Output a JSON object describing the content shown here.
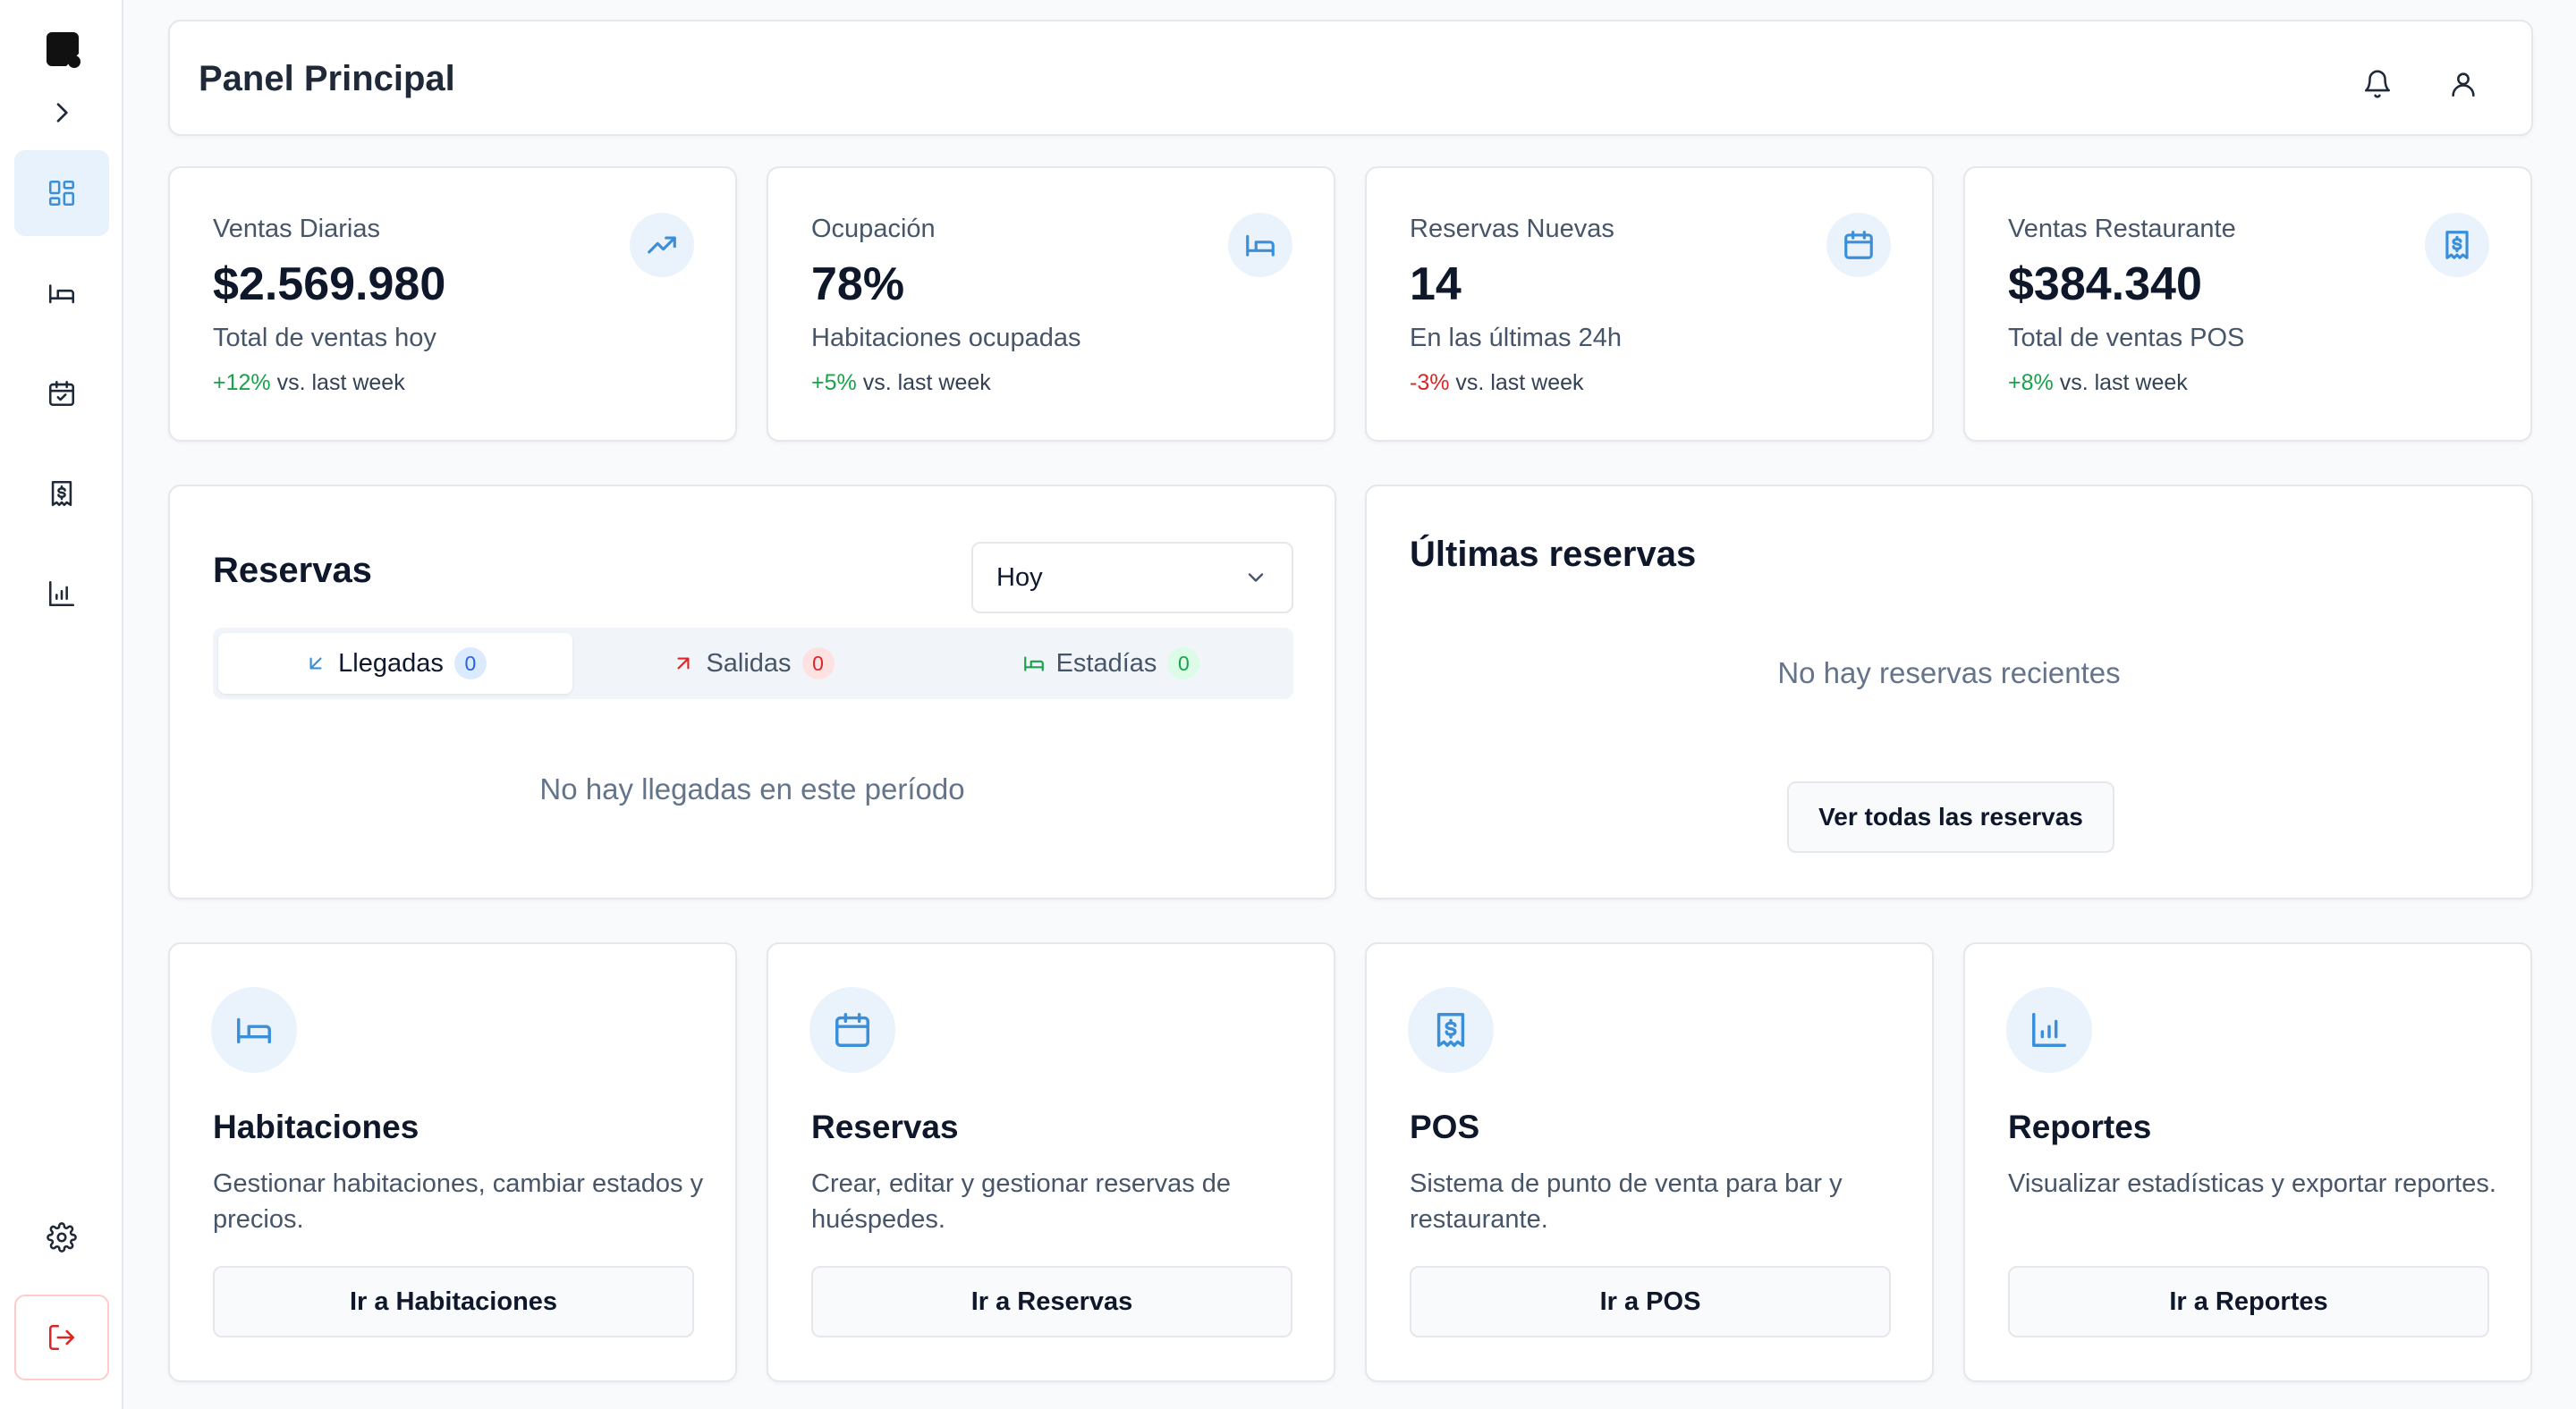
{
  "colors": {
    "accent": "#3b8fd9",
    "positive": "#16a34a",
    "negative": "#dc2626",
    "logout": "#dc2626"
  },
  "sidebar": {
    "logo_icon": "app-logo",
    "expand_icon": "chevron-right-icon",
    "items": [
      {
        "icon": "dashboard-grid-icon",
        "active": true
      },
      {
        "icon": "bed-icon",
        "active": false
      },
      {
        "icon": "calendar-check-icon",
        "active": false
      },
      {
        "icon": "receipt-dollar-icon",
        "active": false
      },
      {
        "icon": "bar-chart-icon",
        "active": false
      }
    ],
    "settings_icon": "gear-icon",
    "logout_icon": "logout-icon"
  },
  "header": {
    "title": "Panel Principal",
    "icons": [
      "bell-icon",
      "user-icon"
    ]
  },
  "stats": [
    {
      "label": "Ventas Diarias",
      "value": "$2.569.980",
      "desc": "Total de ventas hoy",
      "delta": "+12%",
      "delta_suffix": "vs. last week",
      "icon": "trending-up-icon"
    },
    {
      "label": "Ocupación",
      "value": "78%",
      "desc": "Habitaciones ocupadas",
      "delta": "+5%",
      "delta_suffix": "vs. last week",
      "icon": "bed-icon"
    },
    {
      "label": "Reservas Nuevas",
      "value": "14",
      "desc": "En las últimas 24h",
      "delta": "-3%",
      "delta_suffix": "vs. last week",
      "icon": "calendar-icon"
    },
    {
      "label": "Ventas Restaurante",
      "value": "$384.340",
      "desc": "Total de ventas POS",
      "delta": "+8%",
      "delta_suffix": "vs. last week",
      "icon": "receipt-dollar-icon"
    }
  ],
  "reservas": {
    "title": "Reservas",
    "period_selected": "Hoy",
    "tabs": [
      {
        "label": "Llegadas",
        "count": "0",
        "active": true
      },
      {
        "label": "Salidas",
        "count": "0",
        "active": false
      },
      {
        "label": "Estadías",
        "count": "0",
        "active": false
      }
    ],
    "empty_text": "No hay llegadas en este período"
  },
  "ultimas": {
    "title": "Últimas reservas",
    "empty_text": "No hay reservas recientes",
    "button_label": "Ver todas las reservas"
  },
  "modules": [
    {
      "title": "Habitaciones",
      "text": "Gestionar habitaciones, cambiar estados y precios.",
      "button": "Ir a Habitaciones",
      "icon": "bed-icon"
    },
    {
      "title": "Reservas",
      "text": "Crear, editar y gestionar reservas de huéspedes.",
      "button": "Ir a Reservas",
      "icon": "calendar-icon"
    },
    {
      "title": "POS",
      "text": "Sistema de punto de venta para bar y restaurante.",
      "button": "Ir a POS",
      "icon": "receipt-dollar-icon"
    },
    {
      "title": "Reportes",
      "text": "Visualizar estadísticas y exportar reportes.",
      "button": "Ir a Reportes",
      "icon": "bar-chart-icon"
    }
  ]
}
